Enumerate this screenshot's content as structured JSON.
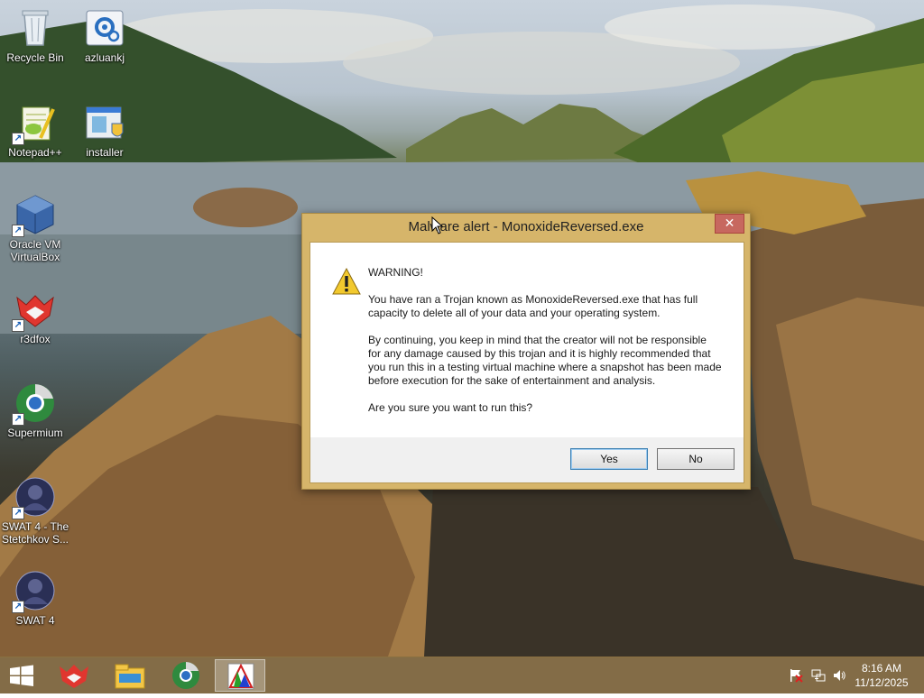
{
  "desktop": {
    "icons": [
      {
        "label": "Recycle Bin",
        "icon": "recycle-bin-icon",
        "shortcut": false
      },
      {
        "label": "azluankj",
        "icon": "settings-app-icon",
        "shortcut": false
      },
      {
        "label": "Notepad++",
        "icon": "notepad-plus-plus-icon",
        "shortcut": true
      },
      {
        "label": "installer",
        "icon": "installer-icon",
        "shortcut": false
      },
      {
        "label": "Oracle VM VirtualBox",
        "icon": "virtualbox-icon",
        "shortcut": true
      },
      {
        "label": "r3dfox",
        "icon": "r3dfox-icon",
        "shortcut": true
      },
      {
        "label": "Supermium",
        "icon": "supermium-icon",
        "shortcut": true
      },
      {
        "label": "SWAT 4 - The Stetchkov S...",
        "icon": "swat4-expansion-icon",
        "shortcut": true
      },
      {
        "label": "SWAT 4",
        "icon": "swat4-icon",
        "shortcut": true
      }
    ]
  },
  "dialog": {
    "title": "Malware alert - MonoxideReversed.exe",
    "close_label": "✕",
    "heading": "WARNING!",
    "paragraph1": "You have ran a Trojan known as MonoxideReversed.exe that has full capacity to delete all of your data and your operating system.",
    "paragraph2": "By continuing, you keep in mind that the creator will not be responsible for any damage caused by this trojan and it is highly recommended that you run this in a testing virtual machine where a snapshot has been made before execution for the sake of entertainment and analysis.",
    "question": "Are you sure you want to run this?",
    "yes_label": "Yes",
    "no_label": "No"
  },
  "taskbar": {
    "pinned": [
      "r3dfox-icon",
      "file-explorer-icon",
      "supermium-icon",
      "monoxide-app-icon"
    ],
    "clock": {
      "time": "8:16 AM",
      "date": "11/12/2025"
    },
    "tray": [
      "action-center-flag-icon",
      "network-icon",
      "volume-icon"
    ]
  },
  "colors": {
    "dialog_frame": "#d6b56a",
    "taskbar": "#785f37",
    "close_button": "#c7685f"
  }
}
